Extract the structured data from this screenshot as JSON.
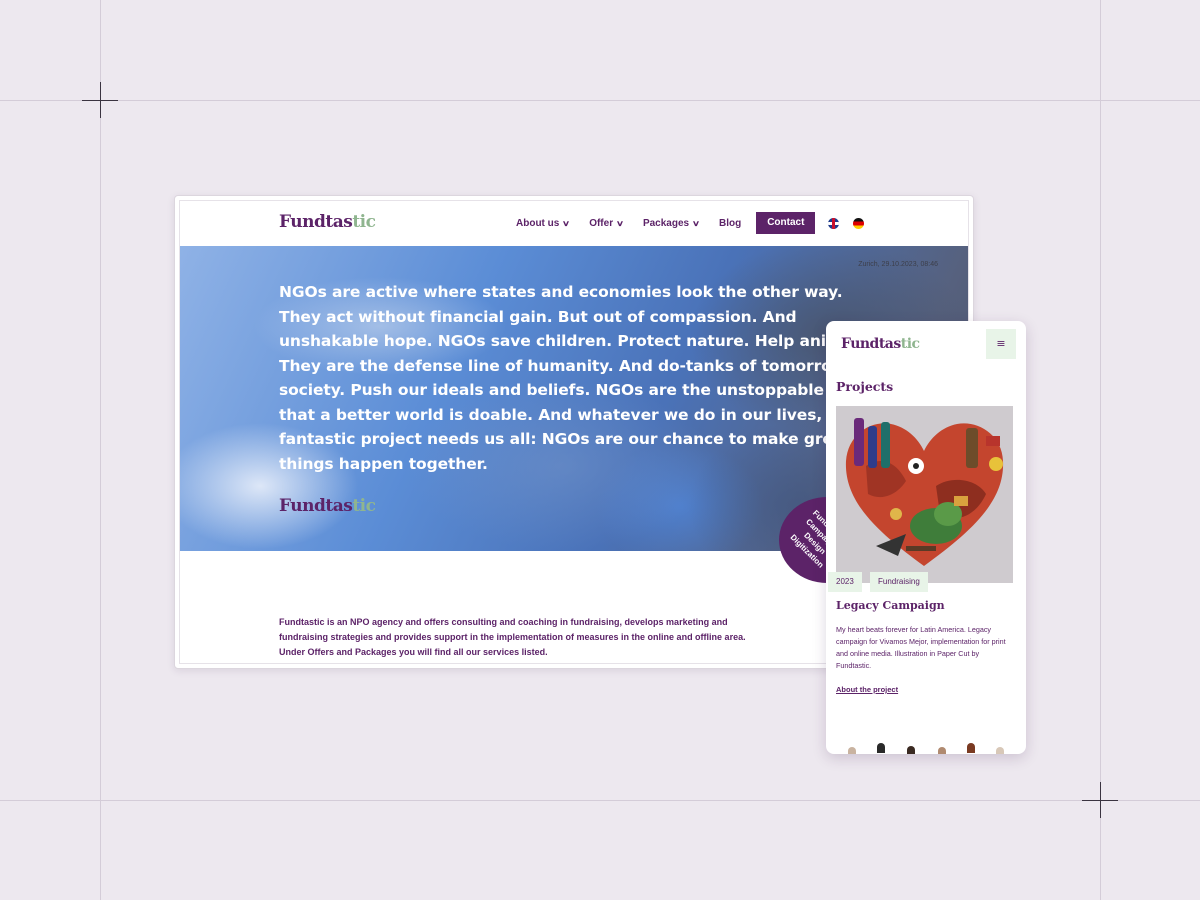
{
  "colors": {
    "brand": "#5c2368",
    "accent_green": "#8fb58f",
    "tag_bg": "#e8f4e8",
    "canvas": "#ede8ef"
  },
  "desktop": {
    "logo": {
      "main": "Fundtas",
      "accent": "tic"
    },
    "nav": {
      "items": [
        {
          "label": "About us",
          "icon": "chevron-down-icon"
        },
        {
          "label": "Offer",
          "icon": "chevron-down-icon"
        },
        {
          "label": "Packages",
          "icon": "chevron-down-icon"
        },
        {
          "label": "Blog"
        }
      ],
      "contact_label": "Contact",
      "languages": [
        "uk-flag-icon",
        "de-flag-icon"
      ]
    },
    "hero": {
      "date": "Zurich, 29.10.2023, 08:46",
      "text": "NGOs are active where states and economies look the other way. They act without financial gain. But out of compassion. And unshakable hope. NGOs save children. Protect nature. Help animals. They are the defense line of humanity. And do-tanks of tomorrow's society. Push our ideals and beliefs. NGOs are the unstoppable proof that a better world is doable. And whatever we do in our lives, this fantastic project needs us all: NGOs are our chance to make great things happen together."
    },
    "badge_text": "Fundraising Campaigns Design Digitization",
    "about_text": "Fundtastic is an NPO agency and offers consulting and coaching in fundraising, develops marketing and fundraising strategies and provides support in the implementation of measures in the online and offline area. Under Offers and Packages you will find all our services listed."
  },
  "mobile": {
    "menu_icon": "≡",
    "section_title": "Projects",
    "tags": [
      "2023",
      "Fundraising"
    ],
    "project_title": "Legacy Campaign",
    "project_desc": "My heart beats forever for Latin America. Legacy campaign for Vivamos Mejor, implementation for print and online media. Illustration in Paper Cut by Fundtastic.",
    "link_label": "About the project"
  }
}
